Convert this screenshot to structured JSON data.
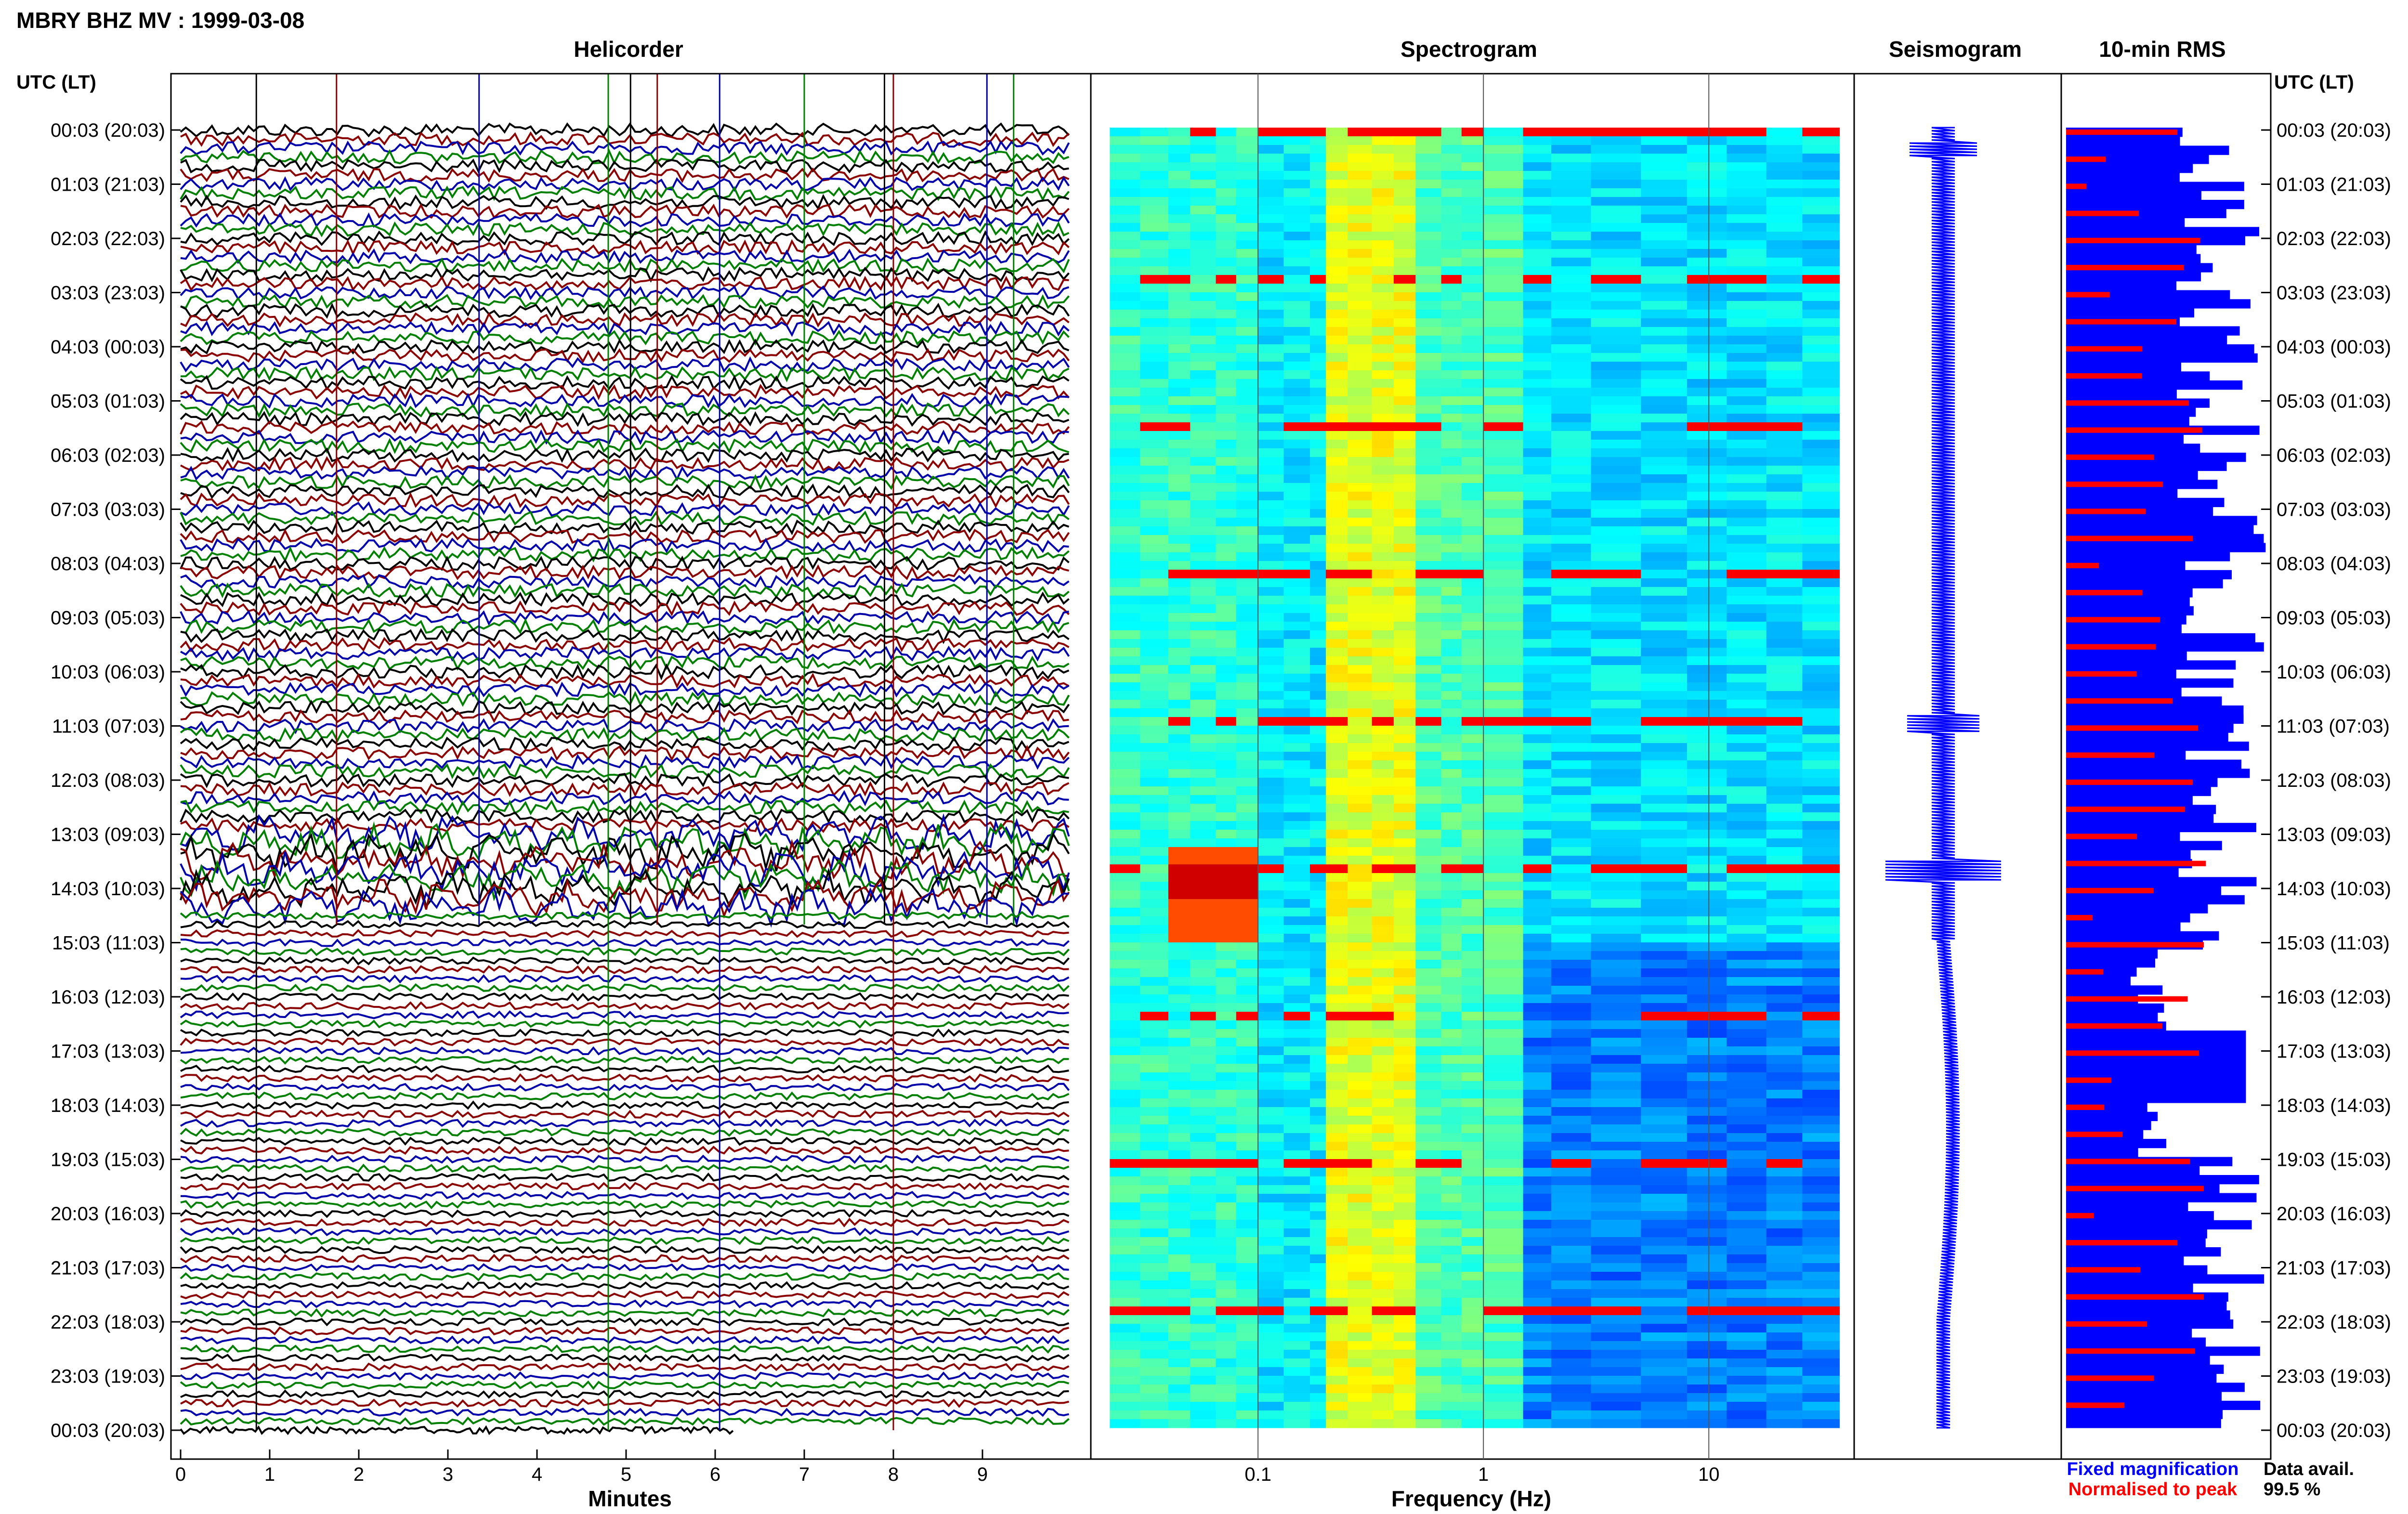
{
  "header": {
    "title": "MBRY BHZ MV : 1999-03-08"
  },
  "panels": {
    "helicorder_title": "Helicorder",
    "spectrogram_title": "Spectrogram",
    "seismogram_title": "Seismogram",
    "rms_title": "10-min RMS"
  },
  "axes": {
    "left_time_label": "UTC (LT)",
    "right_time_label": "UTC (LT)",
    "helicorder_xlabel": "Minutes",
    "spectrogram_xlabel": "Frequency (Hz)"
  },
  "legend": {
    "fixed": "Fixed magnification",
    "normalised": "Normalised to peak",
    "fixed_color": "#0000ff",
    "normalised_color": "#ff0000"
  },
  "availability": {
    "label": "Data avail.",
    "value": "99.5 %"
  },
  "colors": {
    "trace_cycle": [
      "#000000",
      "#8b0000",
      "#0000aa",
      "#008000"
    ],
    "rms_fixed": "#0000ff",
    "rms_normalised": "#ff0000"
  },
  "chart_data": [
    {
      "type": "line",
      "panel": "helicorder",
      "xlabel": "Minutes",
      "xlim": [
        0,
        10
      ],
      "xticks": [
        "0",
        "1",
        "2",
        "3",
        "4",
        "5",
        "6",
        "7",
        "8",
        "9"
      ],
      "row_labels": [
        "00:03 (20:03)",
        "01:03 (21:03)",
        "02:03 (22:03)",
        "03:03 (23:03)",
        "04:03 (00:03)",
        "05:03 (01:03)",
        "06:03 (02:03)",
        "07:03 (03:03)",
        "08:03 (04:03)",
        "09:03 (05:03)",
        "10:03 (06:03)",
        "11:03 (07:03)",
        "12:03 (08:03)",
        "13:03 (09:03)",
        "14:03 (10:03)",
        "15:03 (11:03)",
        "16:03 (12:03)",
        "17:03 (13:03)",
        "18:03 (14:03)",
        "19:03 (15:03)",
        "20:03 (16:03)",
        "21:03 (17:03)",
        "22:03 (18:03)",
        "23:03 (19:03)",
        "00:03 (20:03)"
      ],
      "traces_per_hour": 6,
      "minutes_per_trace": 10
    },
    {
      "type": "heatmap",
      "panel": "spectrogram",
      "xlabel": "Frequency (Hz)",
      "xscale": "log",
      "xlim": [
        0.02,
        40
      ],
      "xticks": [
        "0.1",
        "1",
        "10"
      ],
      "colormap": "jet",
      "features": [
        {
          "freq_range_hz": [
            0.035,
            0.08
          ],
          "time_utc": "13:35",
          "level": "high"
        },
        {
          "freq_range_hz": [
            0.2,
            0.5
          ],
          "time_utc": "00:03-00:03",
          "level": "elevated"
        }
      ]
    },
    {
      "type": "line",
      "panel": "seismogram",
      "events_utc": [
        "00:25",
        "11:00",
        "13:45"
      ]
    },
    {
      "type": "bar",
      "panel": "rms",
      "orientation": "horizontal",
      "series": [
        {
          "name": "Fixed magnification",
          "color": "#0000ff"
        },
        {
          "name": "Normalised to peak",
          "color": "#ff0000"
        }
      ]
    }
  ]
}
